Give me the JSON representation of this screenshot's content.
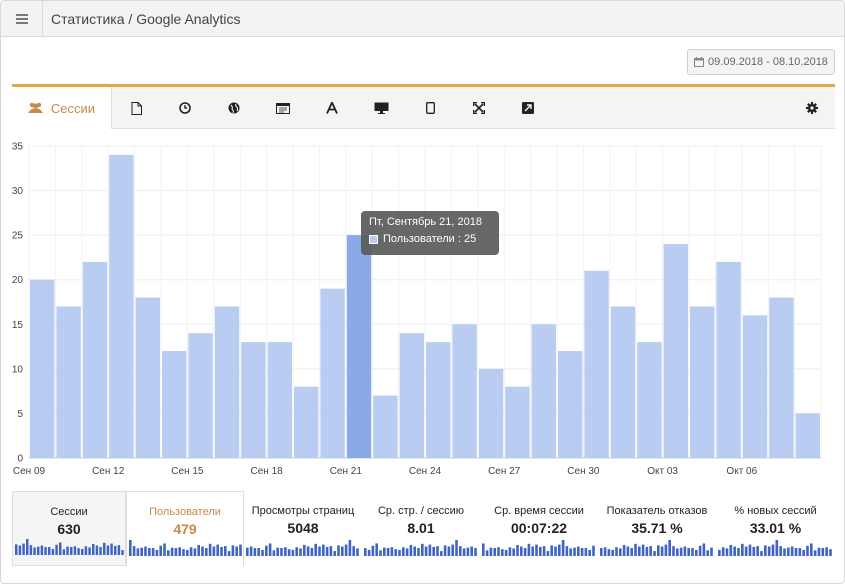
{
  "header": {
    "title": "Статистика / Google Analytics",
    "menu_icon": "hamburger-icon"
  },
  "date_range": {
    "label": "09.09.2018 - 08.10.2018",
    "icon": "calendar-icon"
  },
  "tabs": [
    {
      "label": "Сессии",
      "icon": "users-icon",
      "active": true
    },
    {
      "label": "",
      "icon": "page-icon"
    },
    {
      "label": "",
      "icon": "clock-icon"
    },
    {
      "label": "",
      "icon": "globe-icon"
    },
    {
      "label": "",
      "icon": "browser-window-icon"
    },
    {
      "label": "",
      "icon": "font-icon"
    },
    {
      "label": "",
      "icon": "desktop-icon"
    },
    {
      "label": "",
      "icon": "tablet-icon"
    },
    {
      "label": "",
      "icon": "fullscreen-icon"
    },
    {
      "label": "",
      "icon": "external-link-icon"
    },
    {
      "label": "",
      "icon": "gear-icon"
    }
  ],
  "colors": {
    "accent": "#e0a84a",
    "active_text": "#c9894a",
    "bar": "#b9cdf3",
    "bar_highlight": "#8ba9e6",
    "spark": "#3f64c4"
  },
  "tooltip": {
    "title": "Пт, Сентябрь 21, 2018",
    "text": "Пользователи : 25"
  },
  "chart_data": {
    "type": "bar",
    "ylim": [
      0,
      35
    ],
    "y_ticks": [
      0,
      5,
      10,
      15,
      20,
      25,
      30,
      35
    ],
    "x_tick_labels": [
      "Сен 09",
      "Сен 12",
      "Сен 15",
      "Сен 18",
      "Сен 21",
      "Сен 24",
      "Сен 27",
      "Сен 30",
      "Окт 03",
      "Окт 06"
    ],
    "series": [
      {
        "name": "Пользователи",
        "values": [
          20,
          17,
          22,
          34,
          18,
          12,
          14,
          17,
          13,
          13,
          8,
          19,
          25,
          7,
          14,
          13,
          15,
          10,
          8,
          15,
          12,
          21,
          17,
          13,
          24,
          17,
          22,
          16,
          18,
          5
        ]
      }
    ],
    "highlight_index": 12
  },
  "stats": [
    {
      "label": "Сессии",
      "value": "630"
    },
    {
      "label": "Пользователи",
      "value": "479"
    },
    {
      "label": "Просмотры страниц",
      "value": "5048"
    },
    {
      "label": "Ср. стр. / сессию",
      "value": "8.01"
    },
    {
      "label": "Ср. время сессии",
      "value": "00:07:22"
    },
    {
      "label": "Показатель отказов",
      "value": "35.71 %"
    },
    {
      "label": "% новых сессий",
      "value": "33.01 %"
    }
  ]
}
